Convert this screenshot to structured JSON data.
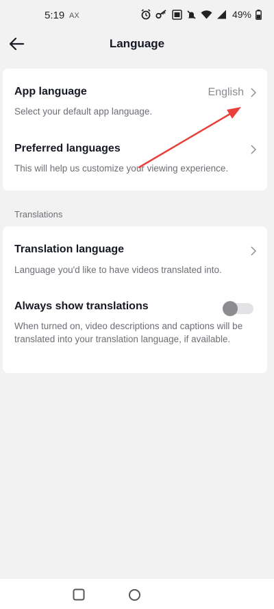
{
  "status": {
    "time": "5:19",
    "carrier": "AX",
    "battery": "49%"
  },
  "header": {
    "title": "Language"
  },
  "general": {
    "app_language": {
      "title": "App language",
      "value": "English",
      "desc": "Select your default app language."
    },
    "preferred_languages": {
      "title": "Preferred languages",
      "desc": "This will help us customize your viewing experience."
    }
  },
  "translations": {
    "section_label": "Translations",
    "translation_language": {
      "title": "Translation language",
      "desc": "Language you'd like to have videos translated into."
    },
    "always_show": {
      "title": "Always show translations",
      "desc": "When turned on, video descriptions and captions will be translated into your translation language, if available.",
      "enabled": false
    }
  },
  "icons": {
    "back": "arrow-left-icon",
    "chevron": "chevron-right-icon",
    "nav_recents": "square-icon",
    "nav_home": "circle-icon"
  },
  "colors": {
    "background": "#f2f2f3",
    "card": "#ffffff",
    "text": "#161823",
    "secondary_text": "#6d6e74",
    "annotation_arrow": "#e8403a"
  }
}
